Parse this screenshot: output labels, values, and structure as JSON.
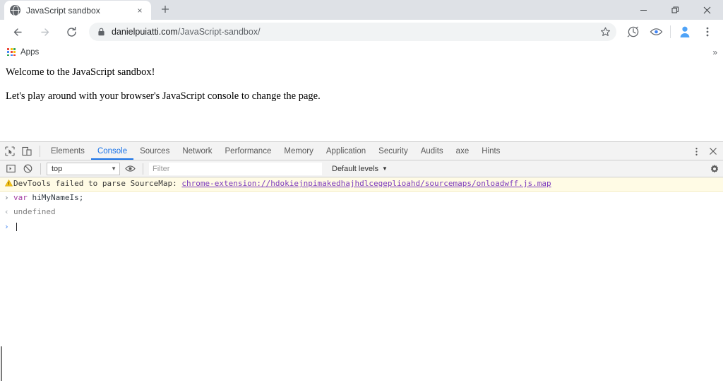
{
  "browser": {
    "tab": {
      "title": "JavaScript sandbox",
      "favicon_name": "globe-favicon",
      "close_label": "×"
    },
    "new_tab_label": "+",
    "window_controls": {
      "minimize": "–",
      "maximize": "❐",
      "close": "✕"
    },
    "toolbar": {
      "back_label": "←",
      "forward_label": "→",
      "reload_label": "↻",
      "url_host": "danielpuiatti.com",
      "url_path": "/JavaScript-sandbox/",
      "lock_name": "lock-icon",
      "star_label": "☆",
      "extension_icon_name": "extension-circle-icon",
      "eye_icon_name": "eye-icon",
      "avatar_name": "profile-avatar",
      "menu_label": "⋮"
    },
    "bookmarks": {
      "apps_label": "Apps",
      "overflow_label": "»",
      "apps_colors": [
        "#ea4335",
        "#fbbc05",
        "#34a853",
        "#4285f4",
        "#ea4335",
        "#fbbc05",
        "#34a853",
        "#4285f4",
        "#ea4335"
      ]
    }
  },
  "page": {
    "heading_line": "Welcome to the JavaScript sandbox!",
    "body_line": "Let's play around with your browser's JavaScript console to change the page."
  },
  "devtools": {
    "inspect_icon_name": "inspect-element-icon",
    "device_icon_name": "device-toolbar-icon",
    "tabs": [
      {
        "label": "Elements",
        "active": false
      },
      {
        "label": "Console",
        "active": true
      },
      {
        "label": "Sources",
        "active": false
      },
      {
        "label": "Network",
        "active": false
      },
      {
        "label": "Performance",
        "active": false
      },
      {
        "label": "Memory",
        "active": false
      },
      {
        "label": "Application",
        "active": false
      },
      {
        "label": "Security",
        "active": false
      },
      {
        "label": "Audits",
        "active": false
      },
      {
        "label": "axe",
        "active": false
      },
      {
        "label": "Hints",
        "active": false
      }
    ],
    "more_label": "⋮",
    "close_label": "✕",
    "filterbar": {
      "execute_icon_name": "console-sidebar-icon",
      "clear_icon_name": "clear-console-icon",
      "context": "top",
      "context_caret": "▼",
      "eye_icon_name": "live-expression-eye-icon",
      "filter_placeholder": "Filter",
      "levels_label": "Default levels",
      "levels_caret": "▼",
      "settings_icon_name": "settings-gear-icon"
    },
    "console_rows": [
      {
        "type": "warning",
        "icon": "warning-triangle-icon",
        "text": "DevTools failed to parse SourceMap: ",
        "link": "chrome-extension://hdokiejnpimakedhajhdlcegeplioahd/sourcemaps/onloadwff.js.map"
      },
      {
        "type": "input",
        "gutter": "›",
        "keyword": "var",
        "identifier": " hiMyNameIs;"
      },
      {
        "type": "output",
        "gutter": "‹",
        "text": "undefined"
      }
    ],
    "prompt_marker": "›"
  },
  "colors": {
    "accent": "#1a73e8",
    "warning_bg": "#fffbe5",
    "link": "#7d3bbd",
    "keyword": "#a33ea3"
  }
}
